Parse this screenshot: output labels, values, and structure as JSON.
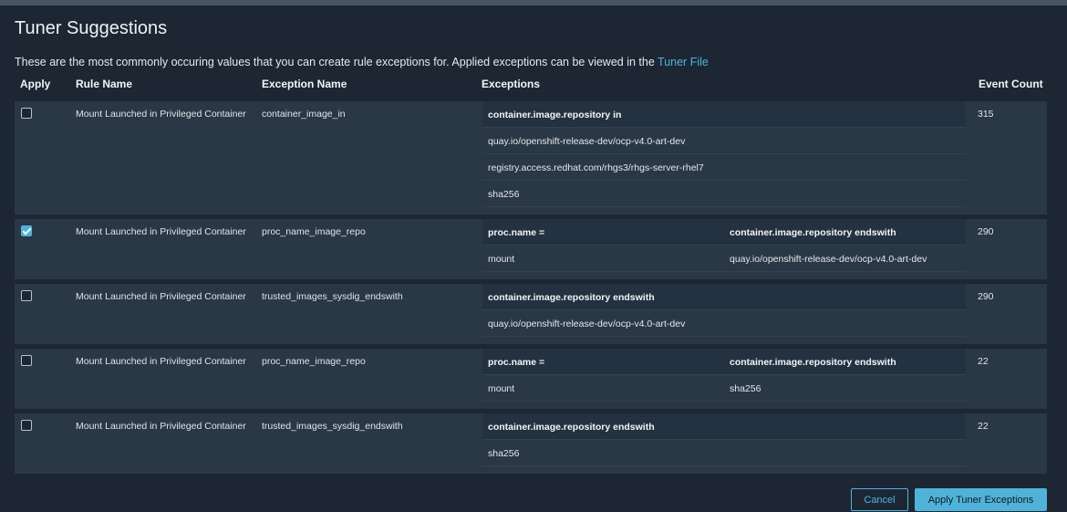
{
  "title": "Tuner Suggestions",
  "description": {
    "text": "These are the most commonly occuring values that you can create rule exceptions for. Applied exceptions can be viewed in the ",
    "link": "Tuner File"
  },
  "columns": {
    "apply": "Apply",
    "rule_name": "Rule Name",
    "exception_name": "Exception Name",
    "exceptions": "Exceptions",
    "event_count": "Event Count"
  },
  "rows": [
    {
      "checked": false,
      "rule_name": "Mount Launched in Privileged Container",
      "exception_name": "container_image_in",
      "event_count": "315",
      "ex_headers": [
        "container.image.repository in",
        ""
      ],
      "ex_values": [
        [
          "quay.io/openshift-release-dev/ocp-v4.0-art-dev",
          ""
        ],
        [
          "registry.access.redhat.com/rhgs3/rhgs-server-rhel7",
          ""
        ],
        [
          "sha256",
          ""
        ]
      ]
    },
    {
      "checked": true,
      "rule_name": "Mount Launched in Privileged Container",
      "exception_name": "proc_name_image_repo",
      "event_count": "290",
      "ex_headers": [
        "proc.name =",
        "container.image.repository endswith"
      ],
      "ex_values": [
        [
          "mount",
          "quay.io/openshift-release-dev/ocp-v4.0-art-dev"
        ]
      ]
    },
    {
      "checked": false,
      "rule_name": "Mount Launched in Privileged Container",
      "exception_name": "trusted_images_sysdig_endswith",
      "event_count": "290",
      "ex_headers": [
        "container.image.repository endswith",
        ""
      ],
      "ex_values": [
        [
          "quay.io/openshift-release-dev/ocp-v4.0-art-dev",
          ""
        ]
      ]
    },
    {
      "checked": false,
      "rule_name": "Mount Launched in Privileged Container",
      "exception_name": "proc_name_image_repo",
      "event_count": "22",
      "ex_headers": [
        "proc.name =",
        "container.image.repository endswith"
      ],
      "ex_values": [
        [
          "mount",
          "sha256"
        ]
      ]
    },
    {
      "checked": false,
      "rule_name": "Mount Launched in Privileged Container",
      "exception_name": "trusted_images_sysdig_endswith",
      "event_count": "22",
      "ex_headers": [
        "container.image.repository endswith",
        ""
      ],
      "ex_values": [
        [
          "sha256",
          ""
        ]
      ]
    }
  ],
  "buttons": {
    "cancel": "Cancel",
    "apply": "Apply Tuner Exceptions"
  },
  "colors": {
    "accent": "#4fb3d9",
    "background": "#1c2733",
    "row": "#2a3744"
  }
}
